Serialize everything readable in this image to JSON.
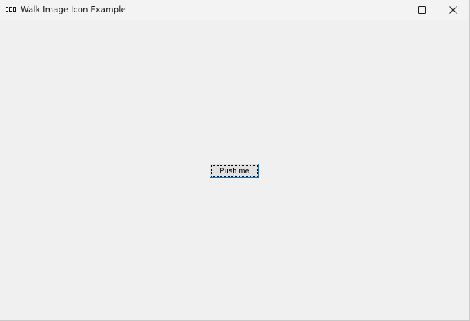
{
  "window": {
    "title": "Walk Image Icon Example",
    "icon": "app-window-icon",
    "controls": {
      "minimize": "minimize-icon",
      "maximize": "maximize-icon",
      "close": "close-icon"
    }
  },
  "main": {
    "button_label": "Push me"
  }
}
